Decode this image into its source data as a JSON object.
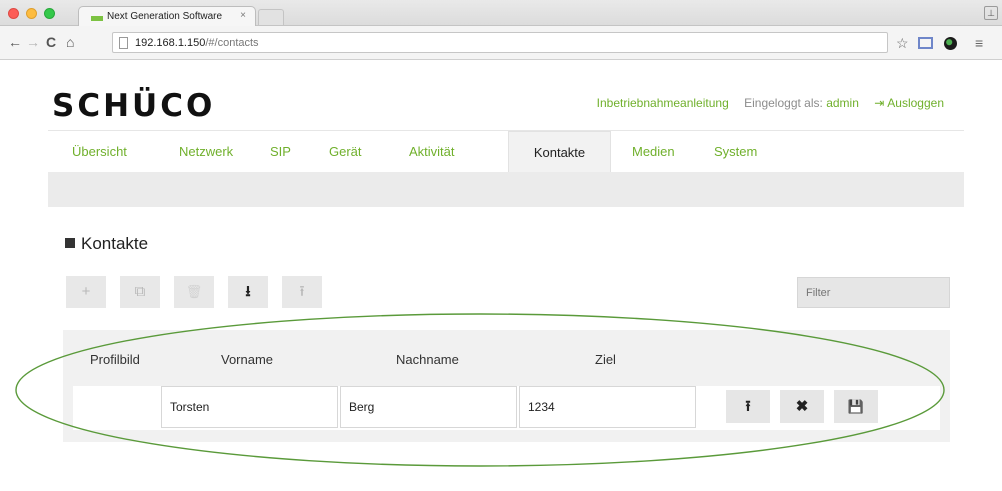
{
  "browser": {
    "tab_title": "Next Generation Software",
    "tab_close": "×",
    "url_host": "192.168.1.150",
    "url_path": "/#/contacts"
  },
  "icons": {
    "back": "←",
    "forward": "→",
    "reload": "C",
    "home": "⌂",
    "star": "☆",
    "menu": "≡",
    "window": "⊥"
  },
  "header": {
    "logo": "SCHÜCO",
    "guide_link": "Inbetriebnahmeanleitung",
    "logged_in_label": "Eingeloggt als:",
    "username": "admin",
    "logout_icon": "⇥",
    "logout": "Ausloggen"
  },
  "nav": {
    "items": [
      {
        "label": "Übersicht"
      },
      {
        "label": "Netzwerk"
      },
      {
        "label": "SIP"
      },
      {
        "label": "Gerät"
      },
      {
        "label": "Aktivität"
      },
      {
        "label": "Kontakte",
        "active": true
      },
      {
        "label": "Medien"
      },
      {
        "label": "System"
      }
    ]
  },
  "contacts": {
    "title": "Kontakte",
    "toolbar": {
      "add": "+",
      "copy": "⧉",
      "delete": "🗑",
      "download": "⭳",
      "upload": "⭱"
    },
    "filter_placeholder": "Filter",
    "columns": [
      "Profilbild",
      "Vorname",
      "Nachname",
      "Ziel"
    ],
    "row": {
      "first_name": "Torsten",
      "last_name": "Berg",
      "target": "1234",
      "upload": "⭱",
      "remove": "✖",
      "save": "💾"
    }
  },
  "colors": {
    "accent": "#70b02c",
    "highlight_ellipse": "#5a9a3a"
  }
}
